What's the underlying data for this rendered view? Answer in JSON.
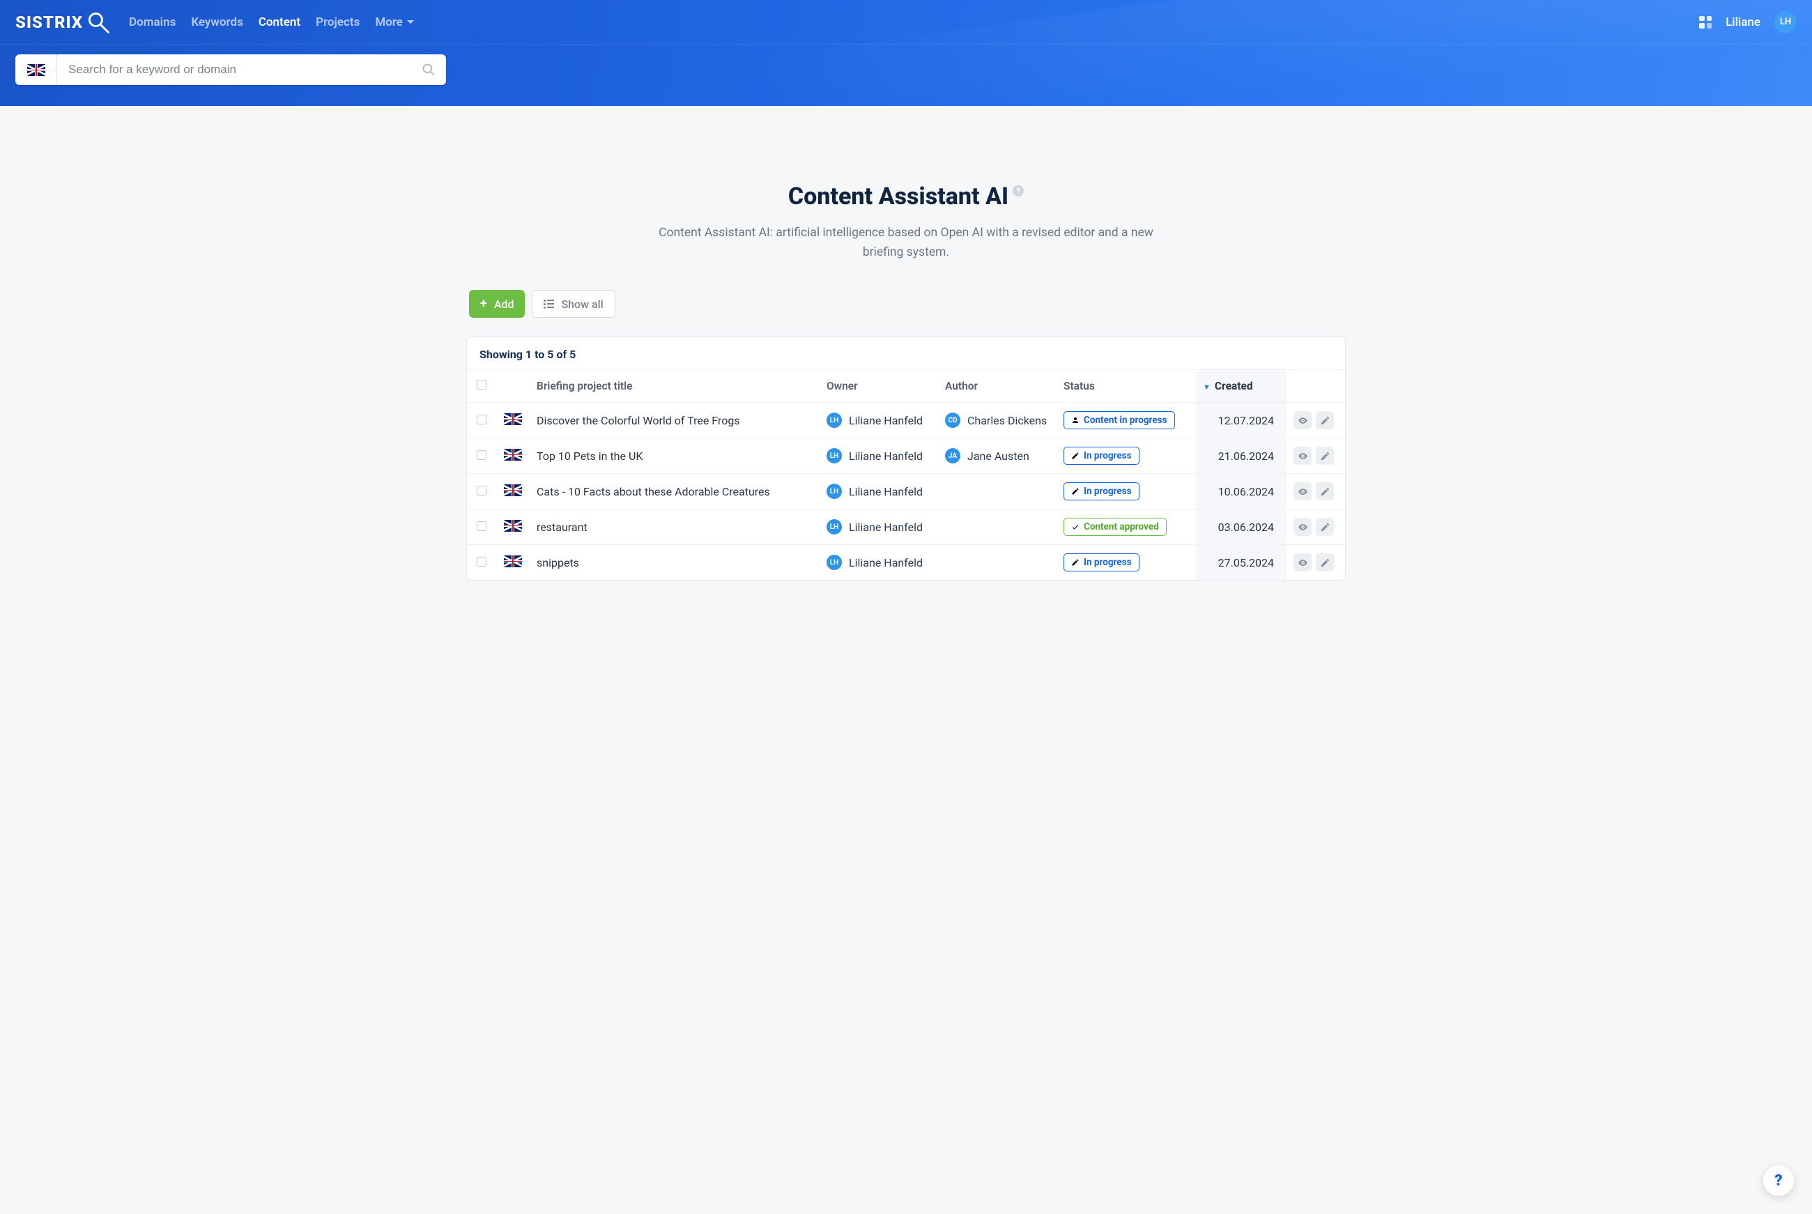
{
  "brand": "SISTRIX",
  "nav": {
    "items": [
      "Domains",
      "Keywords",
      "Content",
      "Projects",
      "More"
    ],
    "active_index": 2
  },
  "user": {
    "name": "Liliane",
    "initials": "LH"
  },
  "search": {
    "placeholder": "Search for a keyword or domain"
  },
  "page": {
    "title": "Content Assistant AI",
    "description": "Content Assistant AI: artificial intelligence based on Open AI with a revised editor and a new briefing system."
  },
  "toolbar": {
    "add": "Add",
    "show_all": "Show all"
  },
  "table": {
    "summary": "Showing 1 to 5 of 5",
    "columns": {
      "title": "Briefing project title",
      "owner": "Owner",
      "author": "Author",
      "status": "Status",
      "created": "Created"
    },
    "rows": [
      {
        "title": "Discover the Colorful World of Tree Frogs",
        "owner": {
          "name": "Liliane Hanfeld",
          "initials": "LH",
          "color": "#2f93ea"
        },
        "author": {
          "name": "Charles Dickens",
          "initials": "CD",
          "color": "#2f93ea"
        },
        "status": {
          "text": "Content in progress",
          "style": "blue",
          "icon": "user"
        },
        "created": "12.07.2024"
      },
      {
        "title": "Top 10 Pets in the UK",
        "owner": {
          "name": "Liliane Hanfeld",
          "initials": "LH",
          "color": "#2f93ea"
        },
        "author": {
          "name": "Jane Austen",
          "initials": "JA",
          "color": "#2f93ea"
        },
        "status": {
          "text": "In progress",
          "style": "blue",
          "icon": "pencil"
        },
        "created": "21.06.2024"
      },
      {
        "title": "Cats - 10 Facts about these Adorable Creatures",
        "owner": {
          "name": "Liliane Hanfeld",
          "initials": "LH",
          "color": "#2f93ea"
        },
        "author": null,
        "status": {
          "text": "In progress",
          "style": "blue",
          "icon": "pencil"
        },
        "created": "10.06.2024"
      },
      {
        "title": "restaurant",
        "owner": {
          "name": "Liliane Hanfeld",
          "initials": "LH",
          "color": "#2f93ea"
        },
        "author": null,
        "status": {
          "text": "Content approved",
          "style": "green",
          "icon": "check"
        },
        "created": "03.06.2024"
      },
      {
        "title": "snippets",
        "owner": {
          "name": "Liliane Hanfeld",
          "initials": "LH",
          "color": "#2f93ea"
        },
        "author": null,
        "status": {
          "text": "In progress",
          "style": "blue",
          "icon": "pencil"
        },
        "created": "27.05.2024"
      }
    ]
  }
}
